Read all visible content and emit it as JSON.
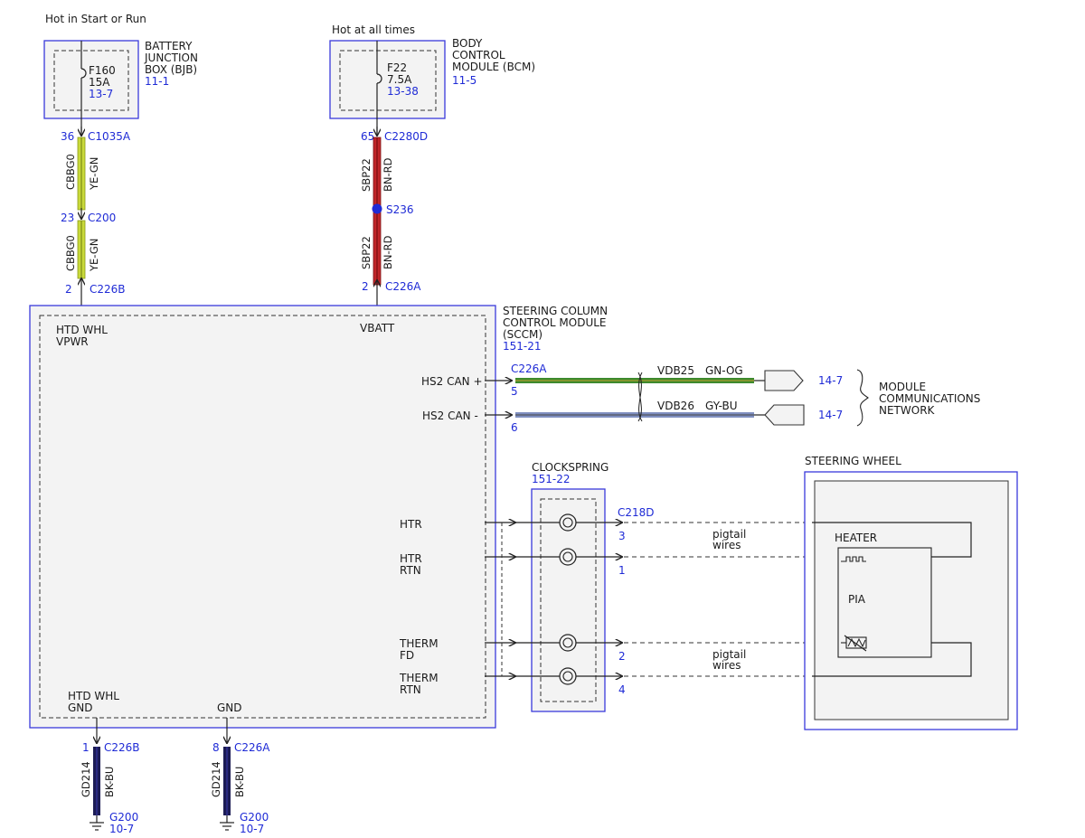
{
  "colors": {
    "box_border": "#3a3adb",
    "box_fill": "#f3f3f3",
    "ref_text": "#1f2bd6",
    "yellow_green_wire": "#c9d93a",
    "red_wire": "#c0262a",
    "green_wire": "#3d8a2e",
    "blue_gray_wire": "#7f8fc0",
    "black_blue_wire": "#1c1c55"
  },
  "bjb": {
    "source": "Hot in Start or Run",
    "name": "BATTERY JUNCTION BOX (BJB)",
    "ref": "11-1",
    "fuse": {
      "name": "F160",
      "rating": "15A",
      "ref": "13-7"
    }
  },
  "bcm": {
    "source": "Hot at all times",
    "name": "BODY CONTROL MODULE (BCM)",
    "ref": "11-5",
    "fuse": {
      "name": "F22",
      "rating": "7.5A",
      "ref": "13-38"
    }
  },
  "wires": {
    "left": {
      "upper": {
        "pin": "36",
        "connector": "C1035A",
        "circuit": "CBBG0",
        "color": "YE-GN"
      },
      "mid": {
        "pin": "23",
        "connector": "C200"
      },
      "lower": {
        "pin": "2",
        "connector": "C226B",
        "circuit": "CBBG0",
        "color": "YE-GN"
      }
    },
    "right": {
      "upper": {
        "pin": "65",
        "connector": "C2280D",
        "circuit": "SBP22",
        "color": "BN-RD"
      },
      "splice": "S236",
      "lower": {
        "pin": "2",
        "connector": "C226A",
        "circuit": "SBP22",
        "color": "BN-RD"
      }
    }
  },
  "sccm": {
    "name": "STEERING COLUMN CONTROL MODULE (SCCM)",
    "ref": "151-21",
    "pins": {
      "htd_whl_vpwr": "HTD WHL VPWR",
      "vbatt": "VBATT",
      "hs2_can_plus": "HS2 CAN +",
      "hs2_can_minus": "HS2 CAN -",
      "htr": "HTR",
      "htr_rtn": "HTR RTN",
      "therm_fd": "THERM FD",
      "therm_rtn": "THERM RTN",
      "htd_whl_gnd": "HTD WHL GND",
      "gnd": "GND"
    }
  },
  "can": {
    "connector": "C226A",
    "plus": {
      "pin": "5",
      "circuit": "VDB25",
      "color": "GN-OG",
      "ref": "14-7"
    },
    "minus": {
      "pin": "6",
      "circuit": "VDB26",
      "color": "GY-BU",
      "ref": "14-7"
    },
    "network": "MODULE COMMUNICATIONS NETWORK"
  },
  "clockspring": {
    "name": "CLOCKSPRING",
    "ref": "151-22",
    "connector": "C218D",
    "pins": [
      "3",
      "1",
      "2",
      "4"
    ],
    "pigtail_label": "pigtail wires"
  },
  "steering_wheel": {
    "name": "STEERING WHEEL",
    "heater": "HEATER",
    "pia": "PIA"
  },
  "grounds": {
    "left": {
      "pin": "1",
      "connector": "C226B",
      "circuit": "GD214",
      "color": "BK-BU",
      "ground": "G200",
      "ref": "10-7"
    },
    "right": {
      "pin": "8",
      "connector": "C226A",
      "circuit": "GD214",
      "color": "BK-BU",
      "ground": "G200",
      "ref": "10-7"
    }
  }
}
